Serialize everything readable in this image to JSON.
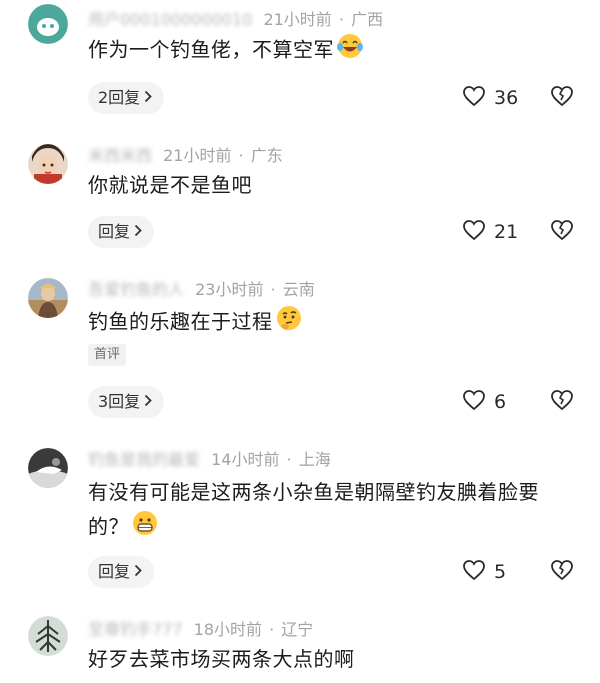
{
  "comments": [
    {
      "name": "用户0001000000010",
      "time": "21小时前",
      "location": "广西",
      "text": "作为一个钓鱼佬，不算空军",
      "emoji": "laughing-crying-emoji",
      "reply_label": "2回复",
      "likes": "36"
    },
    {
      "name": "米西米西",
      "time": "21小时前",
      "location": "广东",
      "text": "你就说是不是鱼吧",
      "reply_label": "回复",
      "likes": "21"
    },
    {
      "name": "吾爱钓鱼的人",
      "time": "23小时前",
      "location": "云南",
      "text": "钓鱼的乐趣在于过程",
      "emoji": "thinking-face-emoji",
      "badge": "首评",
      "reply_label": "3回复",
      "likes": "6"
    },
    {
      "name": "钓鱼是我的最爱",
      "time": "14小时前",
      "location": "上海",
      "text": "有没有可能是这两条小杂鱼是朝隔壁钓友腆着脸要的？",
      "emoji": "grinning-face-emoji",
      "reply_label": "回复",
      "likes": "5"
    },
    {
      "name": "至尊钓手777",
      "time": "18小时前",
      "location": "辽宁",
      "text": "好歹去菜市场买两条大点的啊"
    }
  ],
  "separator": "·",
  "reply_chevron": ">",
  "icons": {
    "like": "heart-outline-icon",
    "dislike": "broken-heart-outline-icon"
  },
  "colors": {
    "meta_text": "#a3a3a3",
    "reply_bg": "#f3f3f3",
    "badge_bg": "#f1f1f1"
  }
}
